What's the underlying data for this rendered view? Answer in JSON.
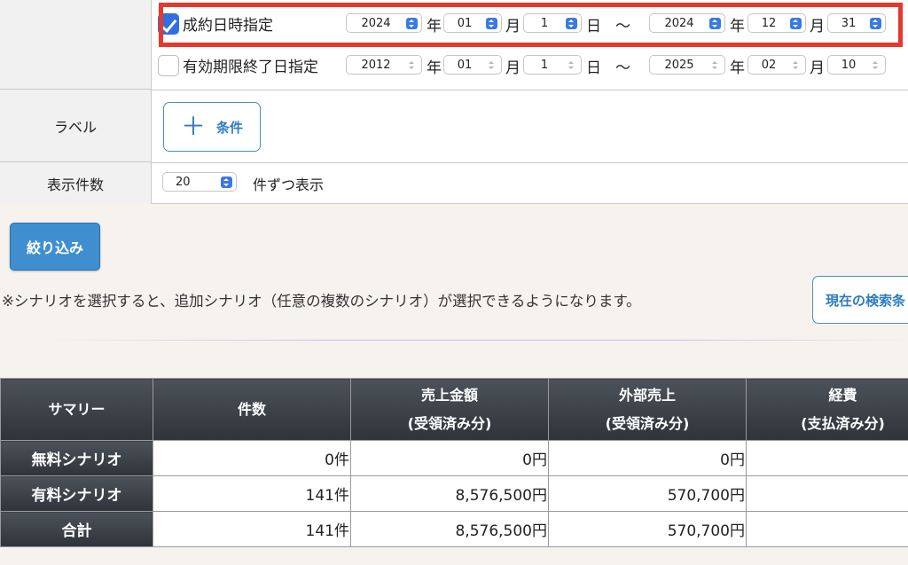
{
  "filters": {
    "date_label": "",
    "contract_date": {
      "checked": true,
      "label": "成約日時指定",
      "from": {
        "year": "2024",
        "month": "01",
        "day": "1"
      },
      "to": {
        "year": "2024",
        "month": "12",
        "day": "31"
      }
    },
    "expiry_date": {
      "checked": false,
      "label": "有効期限終了日指定",
      "from": {
        "year": "2012",
        "month": "01",
        "day": "1"
      },
      "to": {
        "year": "2025",
        "month": "02",
        "day": "10"
      }
    },
    "units": {
      "year": "年",
      "month": "月",
      "day": "日",
      "range": "〜"
    },
    "label_row": {
      "label": "ラベル",
      "add_button": "条件",
      "add_icon": "plus-icon"
    },
    "count_row": {
      "label": "表示件数",
      "value": "20",
      "suffix": "件ずつ表示"
    }
  },
  "filter_button": "絞り込み",
  "note": "※シナリオを選択すると、追加シナリオ（任意の複数のシナリオ）が選択できるようになります。",
  "current_search_button": "現在の検索条",
  "highlight_color": "#e4392c",
  "summary": {
    "headers": [
      "サマリー",
      "件数",
      "売上金額\n(受領済み分)",
      "外部売上\n(受領済み分)",
      "経費\n(支払済み分)"
    ],
    "header_lines": [
      [
        "サマリー"
      ],
      [
        "件数"
      ],
      [
        "売上金額",
        "(受領済み分)"
      ],
      [
        "外部売上",
        "(受領済み分)"
      ],
      [
        "経費",
        "(支払済み分)"
      ]
    ],
    "rows": [
      {
        "label": "無料シナリオ",
        "count": "0件",
        "sales": "0円",
        "external": "0円",
        "expense": ""
      },
      {
        "label": "有料シナリオ",
        "count": "141件",
        "sales": "8,576,500円",
        "external": "570,700円",
        "expense": ""
      },
      {
        "label": "合計",
        "count": "141件",
        "sales": "8,576,500円",
        "external": "570,700円",
        "expense": ""
      }
    ]
  }
}
